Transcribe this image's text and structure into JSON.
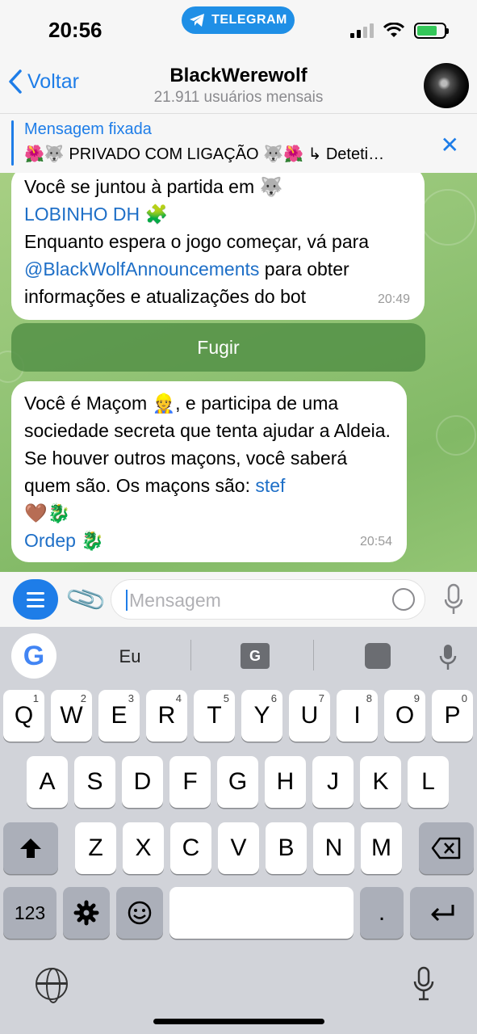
{
  "status_bar": {
    "time": "20:56",
    "app_pill": "TELEGRAM"
  },
  "nav": {
    "back_label": "Voltar",
    "title": "BlackWerewolf",
    "subtitle": "21.911 usuários mensais"
  },
  "pinned": {
    "title": "Mensagem fixada",
    "text": "🌺🐺 PRIVADO COM LIGAÇÃO 🐺🌺 ↳ Deteti…"
  },
  "messages": [
    {
      "line1": "Você se juntou à partida em 🐺",
      "link1": "LOBINHO DH",
      "emoji1": "🧩",
      "line3": "Enquanto espera o jogo começar, vá para",
      "link2": "@BlackWolfAnnouncements",
      "line4a": " para obter",
      "line5": "informações e atualizações do bot",
      "time": "20:49"
    },
    {
      "text1": "Você é Maçom 👷, e participa de uma sociedade secreta que tenta ajudar a Aldeia. Se houver outros maçons, você saberá quem são.  Os maçons são: ",
      "member1": "stef",
      "emoji_after1": "🤎🐉",
      "member2": "Ordep",
      "emoji_after2": "🐉",
      "time": "20:54"
    }
  ],
  "button": {
    "flee_label": "Fugir"
  },
  "input": {
    "placeholder": "Mensagem"
  },
  "keyboard": {
    "suggestion": "Eu",
    "translate_glyph": "G",
    "row1": [
      {
        "k": "Q",
        "n": "1"
      },
      {
        "k": "W",
        "n": "2"
      },
      {
        "k": "E",
        "n": "3"
      },
      {
        "k": "R",
        "n": "4"
      },
      {
        "k": "T",
        "n": "5"
      },
      {
        "k": "Y",
        "n": "6"
      },
      {
        "k": "U",
        "n": "7"
      },
      {
        "k": "I",
        "n": "8"
      },
      {
        "k": "O",
        "n": "9"
      },
      {
        "k": "P",
        "n": "0"
      }
    ],
    "row2": [
      "A",
      "S",
      "D",
      "F",
      "G",
      "H",
      "J",
      "K",
      "L"
    ],
    "row3": [
      "Z",
      "X",
      "C",
      "V",
      "B",
      "N",
      "M"
    ],
    "numbers_key": "123",
    "period_key": ".",
    "shift_icon": "shift-icon",
    "backspace_icon": "backspace-icon",
    "settings_icon": "gear-icon",
    "emoji_icon": "emoji-icon",
    "return_icon": "return-icon"
  },
  "colors": {
    "accent": "#1e7de8",
    "chat_bg": "#93c476",
    "flee_button": "#549146"
  }
}
